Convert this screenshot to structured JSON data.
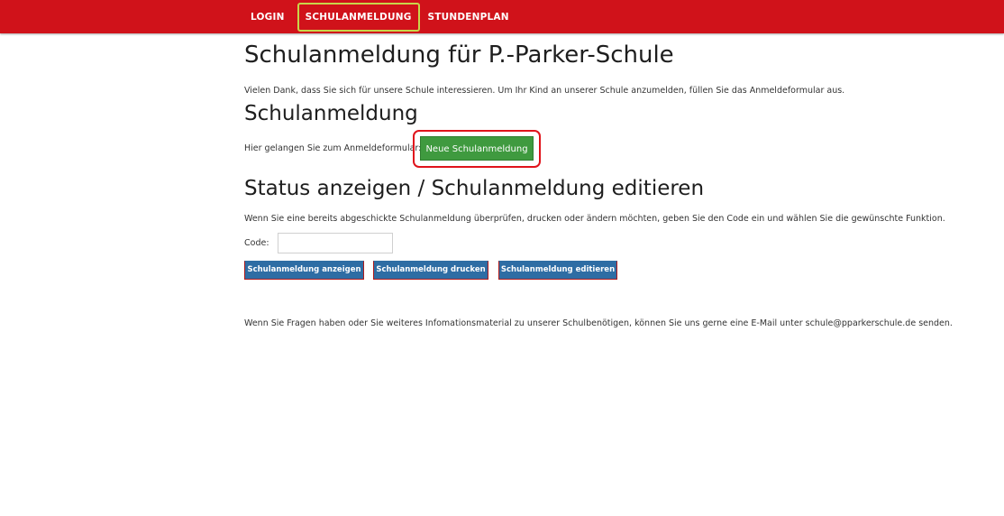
{
  "nav": {
    "items": [
      {
        "label": "LOGIN"
      },
      {
        "label": "SCHULANMELDUNG"
      },
      {
        "label": "STUNDENPLAN"
      }
    ]
  },
  "page": {
    "title": "Schulanmeldung für P.-Parker-Schule",
    "intro": "Vielen Dank, dass Sie sich für unsere Schule interessieren. Um Ihr Kind an unserer Schule anzumelden, füllen Sie das Anmeldeformular aus."
  },
  "registration": {
    "heading": "Schulanmeldung",
    "text": "Hier gelangen Sie zum Anmeldeformular:",
    "button_label": "Neue Schulanmeldung"
  },
  "status": {
    "heading": "Status anzeigen / Schulanmeldung editieren",
    "text": "Wenn Sie eine bereits abgeschickte Schulanmeldung überprüfen, drucken oder ändern möchten, geben Sie den Code ein und wählen Sie die gewünschte Funktion.",
    "code_label": "Code:",
    "code_value": "",
    "buttons": {
      "show": "Schulanmeldung anzeigen",
      "print": "Schulanmeldung drucken",
      "edit": "Schulanmeldung editieren"
    }
  },
  "footer": {
    "text": "Wenn Sie Fragen haben oder Sie weiteres Infomationsmaterial zu unserer Schulbenötigen, können Sie uns gerne eine E-Mail unter schule@pparkerschule.de senden."
  },
  "colors": {
    "nav_bar": "#d0121a",
    "active_nav_border": "#c8d64a",
    "highlight": "#e0141c",
    "primary_button": "#3f9a3f",
    "action_button": "#2e6da4"
  }
}
